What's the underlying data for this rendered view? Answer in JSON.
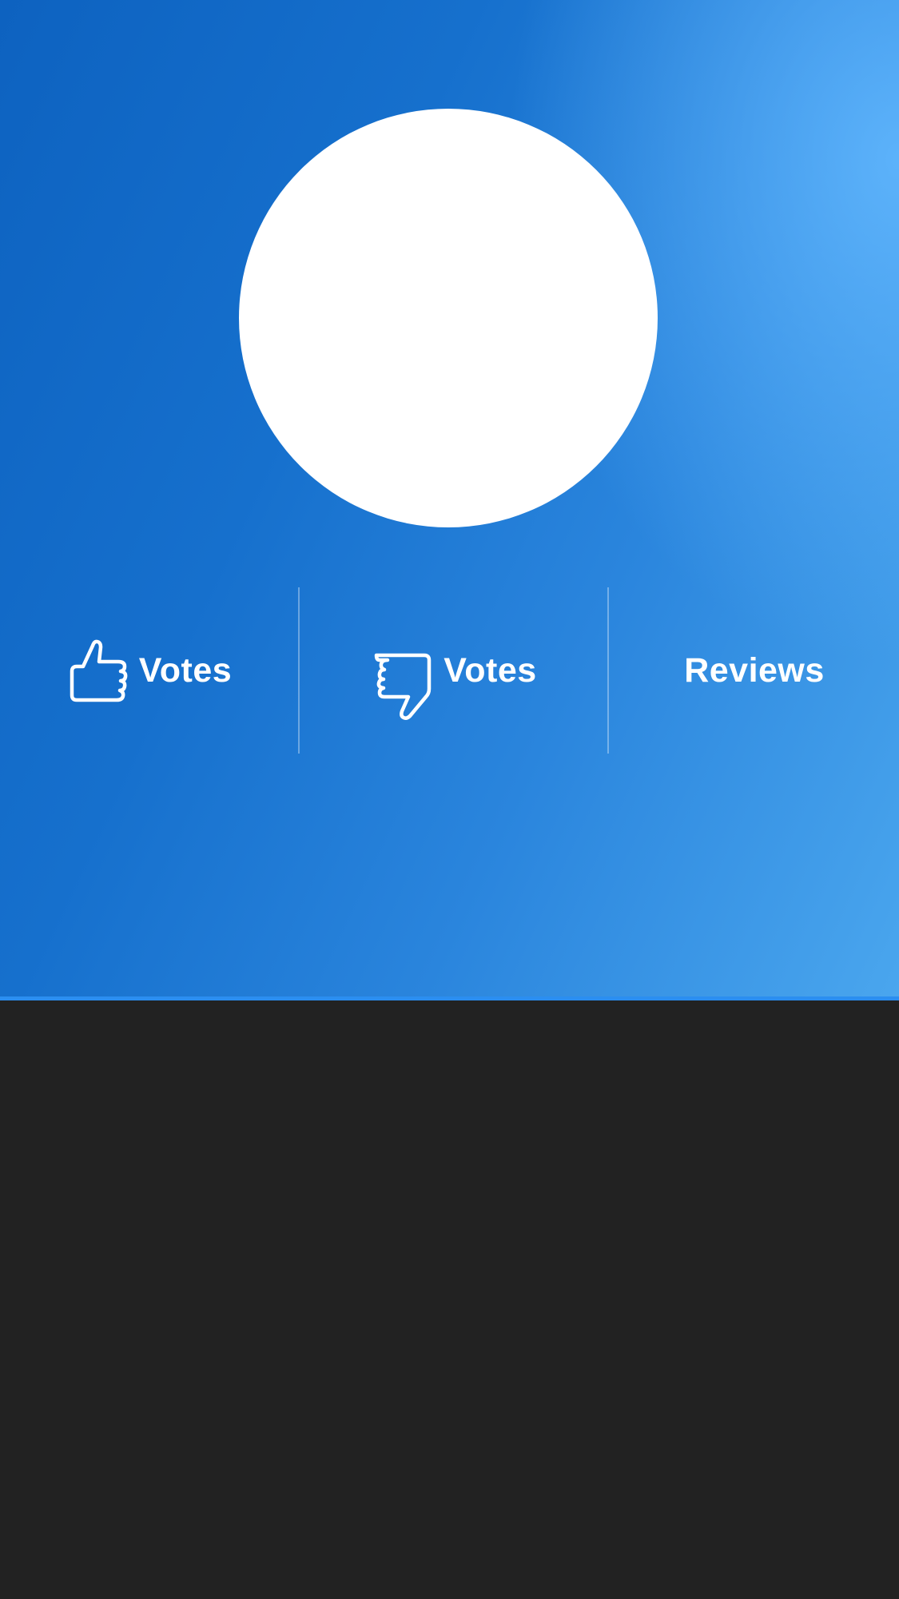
{
  "header": {
    "background_color_start": "#0d62c0",
    "background_color_end": "#4aa6ee",
    "accent_line_color": "#2b8ef0"
  },
  "avatar": {
    "color": "#ffffff"
  },
  "stats": [
    {
      "icon": "thumbs-up-icon",
      "label": "Votes"
    },
    {
      "icon": "thumbs-down-icon",
      "label": "Votes"
    },
    {
      "label": "Reviews"
    }
  ],
  "content": {
    "background_color": "#222222"
  }
}
